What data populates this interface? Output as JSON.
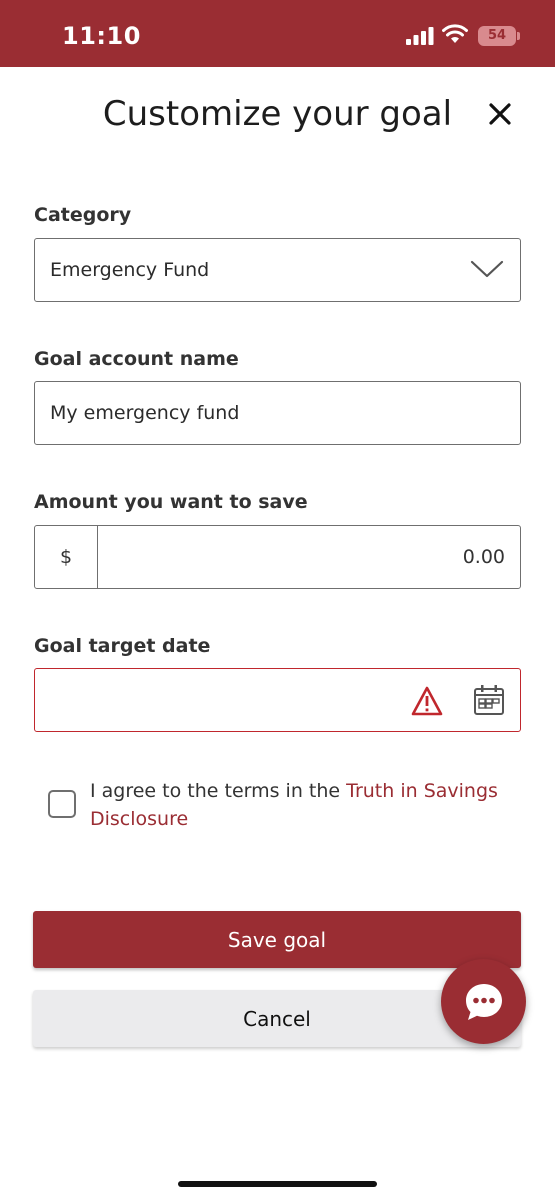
{
  "status_bar": {
    "time": "11:10",
    "battery": "54",
    "background_color": "#9a2d33"
  },
  "header": {
    "title": "Customize your goal",
    "close_icon": "close-icon"
  },
  "form": {
    "category": {
      "label": "Category",
      "selected_value": "Emergency Fund",
      "icon": "chevron-down-icon"
    },
    "goal_account_name": {
      "label": "Goal account name",
      "value": "My emergency fund"
    },
    "amount": {
      "label": "Amount you want to save",
      "currency_symbol": "$",
      "value": "0.00"
    },
    "target_date": {
      "label": "Goal target date",
      "value": "",
      "state": "error",
      "error_color": "#c0272d",
      "icons": [
        "warning-icon",
        "calendar-icon"
      ]
    },
    "terms": {
      "checked": false,
      "text": "I agree to the terms in the ",
      "link_text": "Truth in Savings Disclosure"
    }
  },
  "actions": {
    "save_label": "Save goal",
    "cancel_label": "Cancel"
  },
  "chat": {
    "icon": "chat-bubble-icon"
  },
  "colors": {
    "accent": "#9a2d33",
    "error": "#c0272d",
    "secondary_button": "#ebebed"
  }
}
